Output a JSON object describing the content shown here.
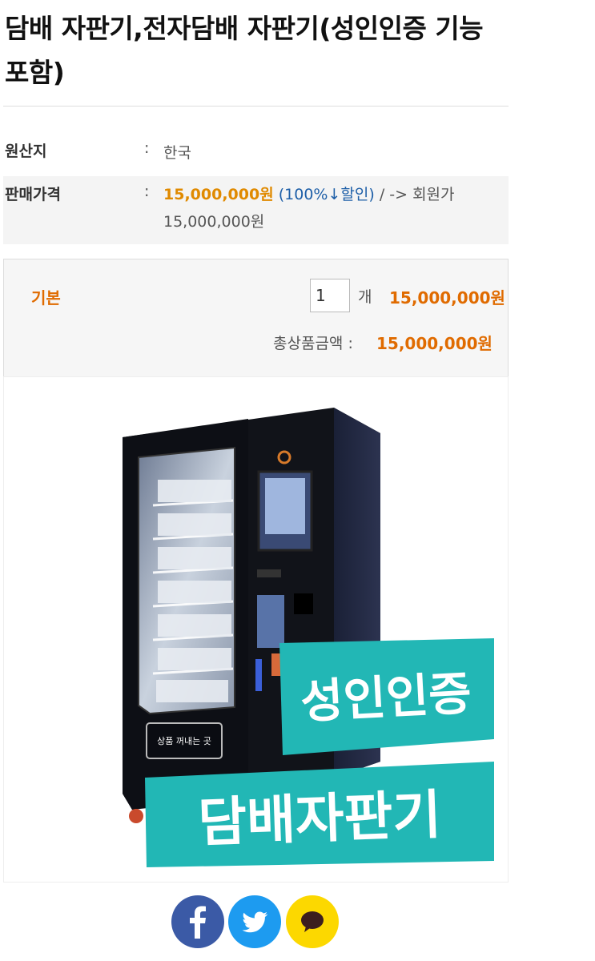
{
  "product": {
    "title": "담배 자판기,전자담배 자판기(성인인증 기능 포함)"
  },
  "info": {
    "origin_label": "원산지",
    "origin_value": "한국",
    "price_label": "판매가격",
    "price_main": "15,000,000원",
    "discount": "(100%↓할인)",
    "member_text": "/ -> 회원가",
    "member_price": "15,000,000원"
  },
  "option": {
    "name": "기본",
    "quantity": "1",
    "unit": "개",
    "price": "15,000,000원",
    "total_label": "총상품금액 :",
    "total_value": "15,000,000원"
  },
  "image": {
    "badge_top": "성인인증",
    "badge_bottom": "담배자판기",
    "slot_label": "상품 꺼내는 곳"
  },
  "share": {
    "icons": [
      "facebook-icon",
      "twitter-icon",
      "kakaotalk-icon"
    ]
  },
  "colors": {
    "accent_orange": "#e08a00",
    "link_blue": "#1e5fa8",
    "badge_teal": "#22b7b5",
    "facebook": "#3b5aa6",
    "twitter": "#1d9bf0",
    "kakao": "#fcd800"
  }
}
